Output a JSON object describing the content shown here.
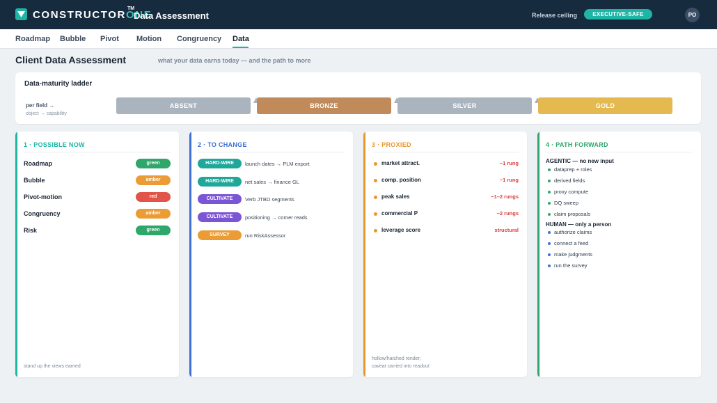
{
  "header": {
    "brand_main": "CONSTRUCTOR",
    "brand_accent": "ONE",
    "brand_tm": "TM",
    "app_title": "Data Assessment",
    "release_label": "Release ceiling",
    "release_value": "EXECUTIVE-SAFE",
    "avatar_initials": "PO"
  },
  "nav": {
    "tabs": [
      {
        "label": "Roadmap"
      },
      {
        "label": "Bubble"
      },
      {
        "label": "Pivot"
      },
      {
        "label": "Motion"
      },
      {
        "label": "Congruency"
      },
      {
        "label": "Data"
      }
    ],
    "active": "Data"
  },
  "page": {
    "title": "Client Data Assessment",
    "subtitle": "what your data earns today — and the path to more"
  },
  "ladder": {
    "title": "Data-maturity ladder",
    "per_field": "per field →",
    "object_capability": "object → capability",
    "rungs": [
      {
        "label": "ABSENT",
        "color": "#a9b4be"
      },
      {
        "label": "BRONZE",
        "color": "#c08a5a"
      },
      {
        "label": "SILVER",
        "color": "#a9b4be"
      },
      {
        "label": "GOLD",
        "color": "#e4b94f"
      }
    ]
  },
  "columns": {
    "possible_now": {
      "heading": "1 · POSSIBLE NOW",
      "accent": "#1fb5a5",
      "rows": [
        {
          "label": "Roadmap",
          "status": "green",
          "color": "#2fa66a"
        },
        {
          "label": "Bubble",
          "status": "amber",
          "color": "#ec9c34"
        },
        {
          "label": "Pivot-motion",
          "status": "red",
          "color": "#e2534a"
        },
        {
          "label": "Congruency",
          "status": "amber",
          "color": "#ec9c34"
        },
        {
          "label": "Risk",
          "status": "green",
          "color": "#2fa66a"
        }
      ],
      "footer": "stand up the views earned"
    },
    "to_change": {
      "heading": "2 · TO CHANGE",
      "accent": "#3d6fd6",
      "rows": [
        {
          "tag": "HARD-WIRE",
          "text": "launch dates → PLM export",
          "color": "#1fa89a"
        },
        {
          "tag": "HARD-WIRE",
          "text": "net sales → finance GL",
          "color": "#1fa89a"
        },
        {
          "tag": "CULTIVATE",
          "text": "Verb JTBD segments",
          "color": "#7a55d6"
        },
        {
          "tag": "CULTIVATE",
          "text": "positioning → corner reads",
          "color": "#7a55d6"
        },
        {
          "tag": "SURVEY",
          "text": "run RiskAssessor",
          "color": "#ec9c34"
        }
      ]
    },
    "proxied": {
      "heading": "3 · PROXIED",
      "accent": "#e9972d",
      "rows": [
        {
          "label": "market attract.",
          "cost": "−1 rung"
        },
        {
          "label": "comp. position",
          "cost": "−1 rung"
        },
        {
          "label": "peak sales",
          "cost": "−1–2 rungs"
        },
        {
          "label": "commercial P",
          "cost": "−2 rungs"
        },
        {
          "label": "leverage score",
          "cost": "structural"
        }
      ],
      "footer_line1": "hollow/hatched render;",
      "footer_line2": "caveat carried into readout"
    },
    "path_forward": {
      "heading": "4 · PATH FORWARD",
      "accent": "#2fa66a",
      "agentic_heading": "AGENTIC — no new input",
      "agentic_color": "#2fa66a",
      "agentic_items": [
        "dataprep + roles",
        "derived fields",
        "proxy compute",
        "DQ sweep",
        "claim proposals"
      ],
      "human_heading": "HUMAN — only a person",
      "human_color": "#3d6fd6",
      "human_items": [
        "authorize claims",
        "connect a feed",
        "make judgments",
        "run the survey"
      ]
    }
  }
}
